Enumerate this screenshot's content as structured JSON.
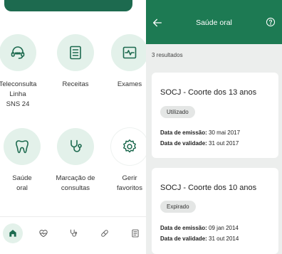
{
  "home": {
    "tiles": [
      {
        "icon": "headset-icon",
        "label_lines": [
          "Teleconsulta",
          "Linha",
          "SNS 24"
        ]
      },
      {
        "icon": "list-document-icon",
        "label_lines": [
          "Receitas"
        ]
      },
      {
        "icon": "pulse-chart-icon",
        "label_lines": [
          "Exames"
        ]
      },
      {
        "icon": "tooth-icon",
        "label_lines": [
          "Saúde",
          "oral"
        ]
      },
      {
        "icon": "stethoscope-icon",
        "label_lines": [
          "Marcação de",
          "consultas"
        ]
      },
      {
        "icon": "gear-icon",
        "label_lines": [
          "Gerir",
          "favoritos"
        ]
      }
    ],
    "bottom_nav": [
      {
        "icon": "home-icon",
        "active": true
      },
      {
        "icon": "heartbeat-icon",
        "active": false
      },
      {
        "icon": "stethoscope-icon",
        "active": false
      },
      {
        "icon": "pill-icon",
        "active": false
      },
      {
        "icon": "document-icon",
        "active": false
      }
    ],
    "colors": {
      "brand": "#1d6a4f",
      "tile_bg": "#e3f1ea"
    }
  },
  "detail": {
    "title": "Saúde oral",
    "results_count": "3 resultados",
    "emission_label": "Data de emissão:",
    "validity_label": "Data de validade:",
    "cards": [
      {
        "title": "SOCJ - Coorte dos 13 anos",
        "status": "Utilizado",
        "emission_date": "30 mai 2017",
        "validity_date": "31 out 2017"
      },
      {
        "title": "SOCJ - Coorte dos 10 anos",
        "status": "Expirado",
        "emission_date": "09 jan 2014",
        "validity_date": "31 out 2014"
      }
    ],
    "colors": {
      "appbar": "#1d7a53",
      "background": "#eceeed"
    }
  }
}
